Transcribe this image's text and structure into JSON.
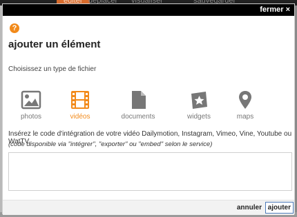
{
  "background": {
    "tabs": [
      "éditer",
      "déplacer",
      "visualiser",
      "sauvegarder"
    ]
  },
  "modal": {
    "close_label": "fermer ×",
    "help_icon": "?",
    "title": "ajouter un élément",
    "subtitle": "Choisissez un type de fichier",
    "file_types": [
      {
        "label": "photos",
        "icon": "image-icon",
        "active": false
      },
      {
        "label": "vidéos",
        "icon": "film-icon",
        "active": true
      },
      {
        "label": "documents",
        "icon": "document-icon",
        "active": false
      },
      {
        "label": "widgets",
        "icon": "widget-star-icon",
        "active": false
      },
      {
        "label": "maps",
        "icon": "map-pin-icon",
        "active": false
      }
    ],
    "instructions": "Insérez le code d'intégration de votre vidéo Dailymotion, Instagram, Vimeo, Vine, Youtube ou WatTV",
    "instructions_note": "(code disponible via \"intégrer\", \"exporter\" ou \"embed\" selon le service)",
    "embed_value": "",
    "cancel_label": "annuler",
    "separator": "|",
    "add_label": "ajouter"
  },
  "colors": {
    "accent": "#f28a1a",
    "icon_gray": "#777777",
    "topbar": "#000000"
  }
}
